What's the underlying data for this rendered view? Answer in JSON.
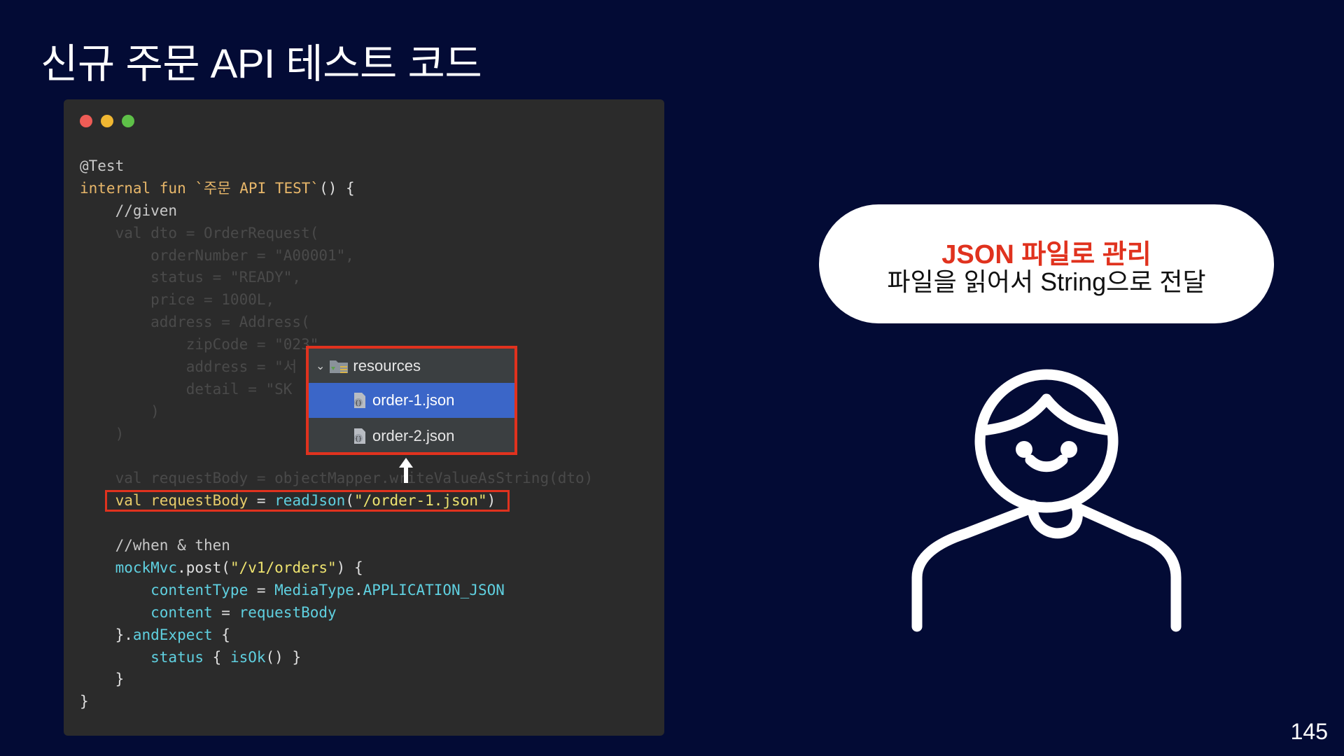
{
  "slide": {
    "title": "신규 주문 API 테스트 코드",
    "page_number": "145"
  },
  "code": {
    "lines": [
      {
        "parts": [
          {
            "t": "@Test",
            "c": "c-ann"
          }
        ]
      },
      {
        "parts": [
          {
            "t": "internal fun `주문 API TEST`",
            "c": "c-kw"
          },
          {
            "t": "() {",
            "c": "c-plain"
          }
        ]
      },
      {
        "parts": [
          {
            "t": "    //given",
            "c": "c-comment"
          }
        ]
      },
      {
        "dim": true,
        "parts": [
          {
            "t": "    val dto = OrderRequest(",
            "c": ""
          }
        ]
      },
      {
        "dim": true,
        "parts": [
          {
            "t": "        orderNumber = \"A00001\",",
            "c": ""
          }
        ]
      },
      {
        "dim": true,
        "parts": [
          {
            "t": "        status = \"READY\",",
            "c": ""
          }
        ]
      },
      {
        "dim": true,
        "parts": [
          {
            "t": "        price = 1000L,",
            "c": ""
          }
        ]
      },
      {
        "dim": true,
        "parts": [
          {
            "t": "        address = Address(",
            "c": ""
          }
        ]
      },
      {
        "dim": true,
        "parts": [
          {
            "t": "            zipCode = \"023\",",
            "c": ""
          }
        ]
      },
      {
        "dim": true,
        "parts": [
          {
            "t": "            address = \"서",
            "c": ""
          }
        ]
      },
      {
        "dim": true,
        "parts": [
          {
            "t": "            detail = \"SK",
            "c": ""
          }
        ]
      },
      {
        "dim": true,
        "parts": [
          {
            "t": "        )",
            "c": ""
          }
        ]
      },
      {
        "dim": true,
        "parts": [
          {
            "t": "    )",
            "c": ""
          }
        ]
      },
      {
        "parts": [
          {
            "t": "",
            "c": ""
          }
        ]
      },
      {
        "dim": true,
        "parts": [
          {
            "t": "    val requestBody = objectMapper.writeValueAsString(dto)",
            "c": ""
          }
        ]
      },
      {
        "parts": [
          {
            "t": "    val requestBody",
            "c": "c-id"
          },
          {
            "t": " = ",
            "c": "c-plain"
          },
          {
            "t": "readJson",
            "c": "c-fn"
          },
          {
            "t": "(",
            "c": "c-plain"
          },
          {
            "t": "\"/order-1.json\"",
            "c": "c-str"
          },
          {
            "t": ")",
            "c": "c-plain"
          }
        ]
      },
      {
        "parts": [
          {
            "t": "",
            "c": ""
          }
        ]
      },
      {
        "parts": [
          {
            "t": "    //when & then",
            "c": "c-comment"
          }
        ]
      },
      {
        "parts": [
          {
            "t": "    mockMvc",
            "c": "c-prop"
          },
          {
            "t": ".post(",
            "c": "c-plain"
          },
          {
            "t": "\"/v1/orders\"",
            "c": "c-str"
          },
          {
            "t": ") {",
            "c": "c-plain"
          }
        ]
      },
      {
        "parts": [
          {
            "t": "        contentType",
            "c": "c-prop"
          },
          {
            "t": " = ",
            "c": "c-plain"
          },
          {
            "t": "MediaType",
            "c": "c-prop"
          },
          {
            "t": ".",
            "c": "c-plain"
          },
          {
            "t": "APPLICATION_JSON",
            "c": "c-prop"
          }
        ]
      },
      {
        "parts": [
          {
            "t": "        content",
            "c": "c-prop"
          },
          {
            "t": " = ",
            "c": "c-plain"
          },
          {
            "t": "requestBody",
            "c": "c-prop"
          }
        ]
      },
      {
        "parts": [
          {
            "t": "    }.",
            "c": "c-plain"
          },
          {
            "t": "andExpect",
            "c": "c-fn"
          },
          {
            "t": " {",
            "c": "c-plain"
          }
        ]
      },
      {
        "parts": [
          {
            "t": "        status",
            "c": "c-prop"
          },
          {
            "t": " { ",
            "c": "c-plain"
          },
          {
            "t": "isOk",
            "c": "c-fn"
          },
          {
            "t": "() }",
            "c": "c-plain"
          }
        ]
      },
      {
        "parts": [
          {
            "t": "    }",
            "c": "c-plain"
          }
        ]
      },
      {
        "parts": [
          {
            "t": "}",
            "c": "c-plain"
          }
        ]
      }
    ]
  },
  "resources_popup": {
    "folder_label": "resources",
    "items": [
      {
        "label": "order-1.json",
        "selected": true
      },
      {
        "label": "order-2.json",
        "selected": false
      }
    ]
  },
  "bubble": {
    "title": "JSON 파일로 관리",
    "subtitle": "파일을 읽어서 String으로 전달"
  },
  "colors": {
    "background": "#030b35",
    "code_window": "#2b2b2b",
    "highlight_border": "#e0321e",
    "selection": "#3b66c8"
  },
  "icons": {
    "window_controls": [
      "close-dot",
      "minimize-dot",
      "maximize-dot"
    ],
    "folder": "resources-folder-icon",
    "file": "json-file-icon",
    "arrow": "up-arrow-icon",
    "person": "person-icon"
  }
}
